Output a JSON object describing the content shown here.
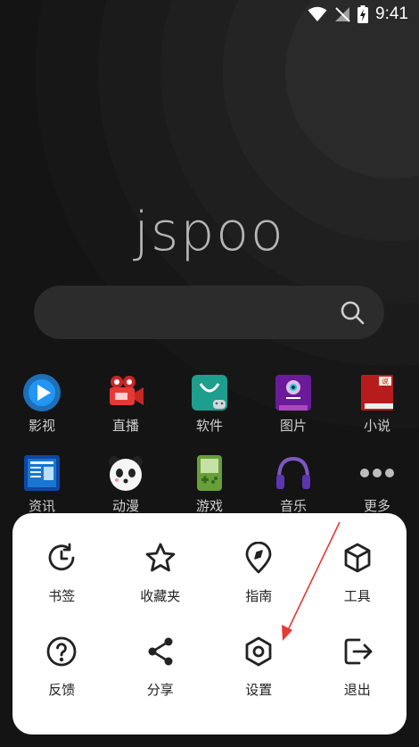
{
  "status_bar": {
    "time": "9:41"
  },
  "logo": {
    "text": "jspoo"
  },
  "search": {
    "placeholder": ""
  },
  "apps": [
    {
      "label": "影视",
      "icon": "play-icon",
      "color": "#1e88e5"
    },
    {
      "label": "直播",
      "icon": "camera-icon",
      "color": "#e53935"
    },
    {
      "label": "软件",
      "icon": "android-bag-icon",
      "color": "#26a69a"
    },
    {
      "label": "图片",
      "icon": "monster-icon",
      "color": "#7b1fa2"
    },
    {
      "label": "小说",
      "icon": "book-icon",
      "color": "#c62828"
    },
    {
      "label": "资讯",
      "icon": "newspaper-icon",
      "color": "#1565c0"
    },
    {
      "label": "动漫",
      "icon": "panda-icon",
      "color": "#ffffff"
    },
    {
      "label": "游戏",
      "icon": "gameboy-icon",
      "color": "#7cb342"
    },
    {
      "label": "音乐",
      "icon": "headphones-icon",
      "color": "#5e35b1"
    },
    {
      "label": "更多",
      "icon": "more-dots-icon",
      "color": "#bdbdbd"
    }
  ],
  "menu": [
    {
      "label": "书签",
      "icon": "history-clock-icon"
    },
    {
      "label": "收藏夹",
      "icon": "star-icon"
    },
    {
      "label": "指南",
      "icon": "compass-pin-icon"
    },
    {
      "label": "工具",
      "icon": "cube-icon"
    },
    {
      "label": "反馈",
      "icon": "help-circle-icon"
    },
    {
      "label": "分享",
      "icon": "share-icon"
    },
    {
      "label": "设置",
      "icon": "settings-hex-icon"
    },
    {
      "label": "退出",
      "icon": "logout-icon"
    }
  ],
  "annotation": {
    "color": "#e53935"
  }
}
